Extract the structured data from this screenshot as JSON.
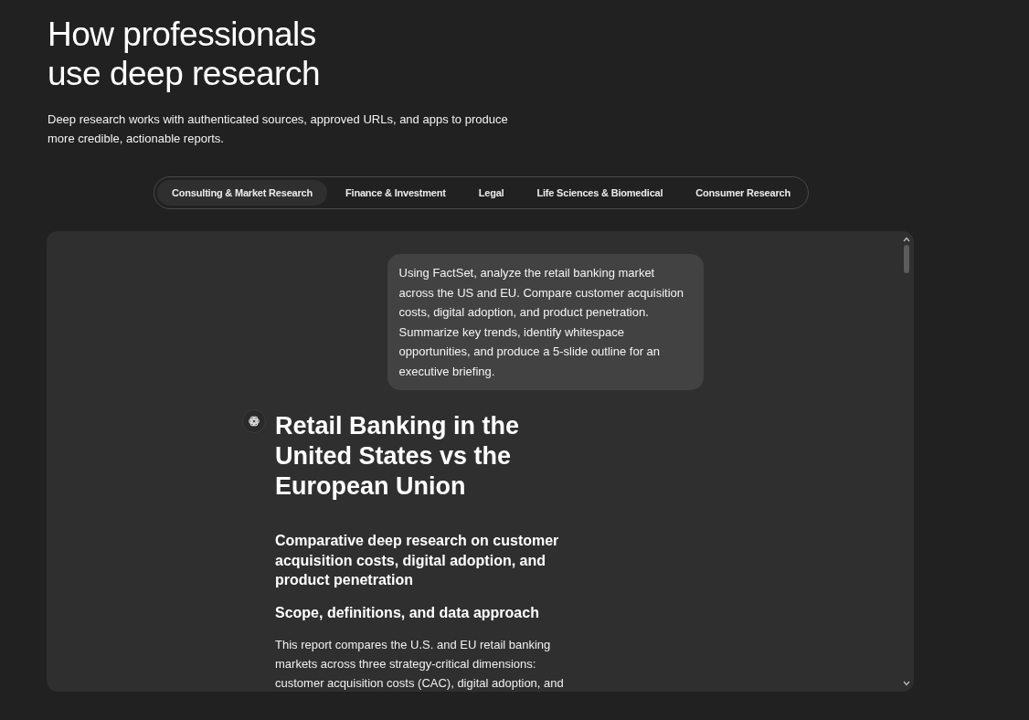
{
  "intro": {
    "title": "How professionals\nuse deep research",
    "subtitle": "Deep research works with authenticated sources, approved URLs, and apps to produce\nmore credible, actionable reports."
  },
  "tabs": [
    {
      "label": "Consulting & Market Research",
      "selected": true
    },
    {
      "label": "Finance & Investment",
      "selected": false
    },
    {
      "label": "Legal",
      "selected": false
    },
    {
      "label": "Life Sciences & Biomedical",
      "selected": false
    },
    {
      "label": "Consumer Research",
      "selected": false
    }
  ],
  "chat": {
    "prompt": "Using FactSet, analyze the retail banking market\nacross the US and EU. Compare customer acquisition\ncosts, digital adoption, and product penetration.\nSummarize key trends, identify whitespace\nopportunities, and produce a 5-slide outline for an\nexecutive briefing.",
    "report": {
      "title": "Retail Banking in the\nUnited States vs the\nEuropean Union",
      "subtitle": "Comparative deep research on customer\nacquisition costs, digital adoption, and\nproduct penetration",
      "section_heading": "Scope, definitions, and data approach",
      "paragraph": "This report compares the U.S. and EU retail banking\nmarkets across three strategy-critical dimensions:\ncustomer acquisition costs (CAC), digital adoption, and"
    }
  }
}
